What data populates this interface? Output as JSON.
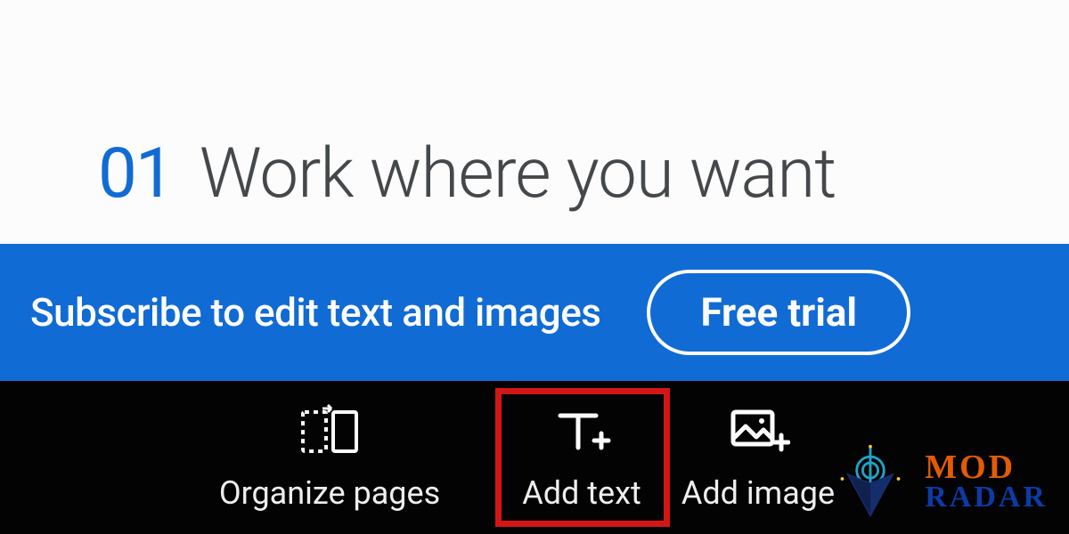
{
  "document": {
    "number": "01",
    "title": "Work where you want"
  },
  "banner": {
    "message": "Subscribe to edit text and images",
    "cta_label": "Free trial"
  },
  "toolbar": {
    "organize_label": "Organize pages",
    "add_text_label": "Add text",
    "add_image_label": "Add image"
  },
  "watermark": {
    "line1": "MOD",
    "line2": "RADAR"
  }
}
